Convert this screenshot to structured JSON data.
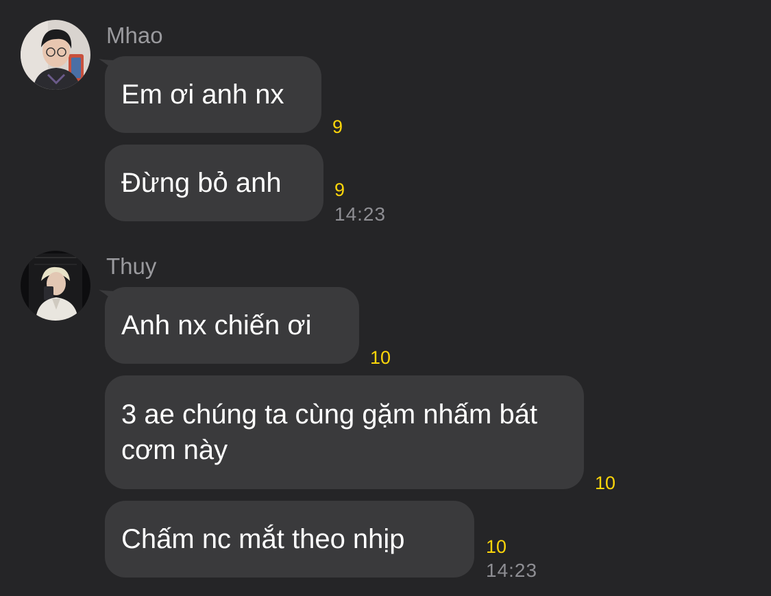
{
  "messages": [
    {
      "sender": "Mhao",
      "bubbles": [
        {
          "text": "Em ơi anh nx",
          "count": "9"
        },
        {
          "text": "Đừng bỏ anh",
          "count": "9",
          "time": "14:23"
        }
      ]
    },
    {
      "sender": "Thuy",
      "bubbles": [
        {
          "text": "Anh nx chiến ơi",
          "count": "10"
        },
        {
          "text": "3 ae chúng ta cùng gặm nhấm bát cơm này",
          "count": "10"
        },
        {
          "text": "Chấm nc mắt theo nhịp",
          "count": "10",
          "time": "14:23"
        }
      ]
    }
  ],
  "colors": {
    "background": "#252527",
    "bubble": "#3a3a3c",
    "count": "#ffd60a",
    "sender": "#9a9a9e",
    "time": "#8e8e93"
  },
  "icons": [
    "avatar-mhao",
    "avatar-thuy"
  ]
}
